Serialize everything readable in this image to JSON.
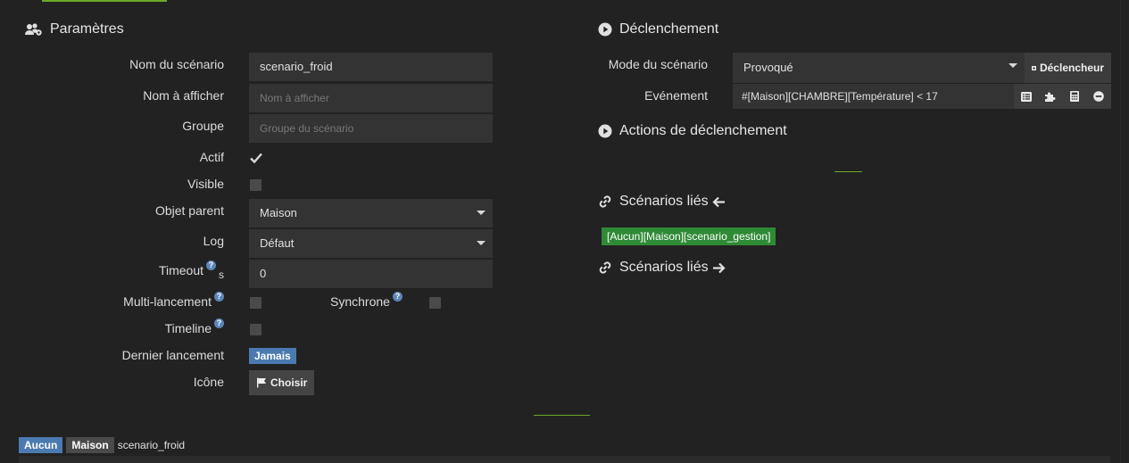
{
  "params": {
    "title": "Paramètres",
    "fields": {
      "name_label": "Nom du scénario",
      "name_value": "scenario_froid",
      "display_label": "Nom à afficher",
      "display_placeholder": "Nom à afficher",
      "group_label": "Groupe",
      "group_placeholder": "Groupe du scénario",
      "active_label": "Actif",
      "active_checked": true,
      "visible_label": "Visible",
      "visible_checked": false,
      "parent_label": "Objet parent",
      "parent_value": "Maison",
      "log_label": "Log",
      "log_value": "Défaut",
      "timeout_label": "Timeout",
      "timeout_unit": "s",
      "timeout_value": "0",
      "multi_label": "Multi-lancement",
      "sync_label": "Synchrone",
      "timeline_label": "Timeline",
      "last_run_label": "Dernier lancement",
      "last_run_value": "Jamais",
      "icon_label": "Icône",
      "icon_button": "Choisir"
    },
    "help_glyph": "?"
  },
  "trigger": {
    "title": "Déclenchement",
    "mode_label": "Mode du scénario",
    "mode_value": "Provoqué",
    "trigger_button": "Déclencheur",
    "event_label": "Evénement",
    "event_value": "#[Maison][CHAMBRE][Température] < 17"
  },
  "trigger_actions": {
    "title": "Actions de déclenchement"
  },
  "linked_in": {
    "title": "Scénarios liés",
    "items": [
      "[Aucun][Maison][scenario_gestion]"
    ]
  },
  "linked_out": {
    "title": "Scénarios liés"
  },
  "footer": {
    "badge1": "Aucun",
    "badge2": "Maison",
    "name": "scenario_froid"
  },
  "colors": {
    "accent_green": "#6fa82a",
    "badge_blue": "#4a7ab0",
    "linked_green": "#2f8a36",
    "panel_bg": "#222222",
    "input_bg": "#333333"
  },
  "icons": [
    "users-cog-icon",
    "play-circle-icon",
    "link-icon",
    "arrow-left-icon",
    "arrow-right-icon",
    "flag-icon",
    "plus-square-icon",
    "list-icon",
    "puzzle-icon",
    "calculator-icon",
    "minus-circle-icon",
    "check-icon",
    "question-circle-icon",
    "caret-down-icon"
  ]
}
